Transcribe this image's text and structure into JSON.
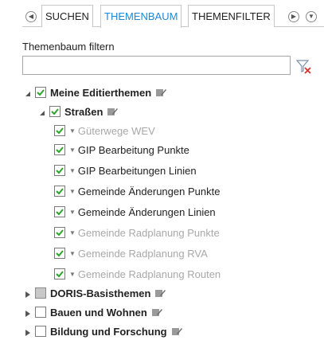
{
  "tabs": {
    "prev_glyph": "◀",
    "next_glyph": "▶",
    "down_glyph": "▼",
    "items": [
      {
        "label": "SUCHEN"
      },
      {
        "label": "THEMENBAUM"
      },
      {
        "label": "THEMENFILTER"
      }
    ]
  },
  "filter": {
    "label": "Themenbaum filtern",
    "value": ""
  },
  "tree": {
    "meine": {
      "label": "Meine Editierthemen"
    },
    "strassen": {
      "label": "Straßen"
    },
    "layers": [
      {
        "label": "Güterwege WEV"
      },
      {
        "label": "GIP Bearbeitung Punkte"
      },
      {
        "label": "GIP Bearbeitungen Linien"
      },
      {
        "label": "Gemeinde Änderungen Punkte"
      },
      {
        "label": "Gemeinde Änderungen Linien"
      },
      {
        "label": "Gemeinde Radplanung Punkte"
      },
      {
        "label": "Gemeinde Radplanung RVA"
      },
      {
        "label": "Gemeinde Radplanung Routen"
      }
    ],
    "groups": [
      {
        "label": "DORIS-Basisthemen"
      },
      {
        "label": "Bauen und Wohnen"
      },
      {
        "label": "Bildung und Forschung"
      }
    ]
  },
  "colors": {
    "accent": "#1e88d6",
    "check_green": "#2aa52a",
    "dim_text": "#a8a8a8"
  }
}
